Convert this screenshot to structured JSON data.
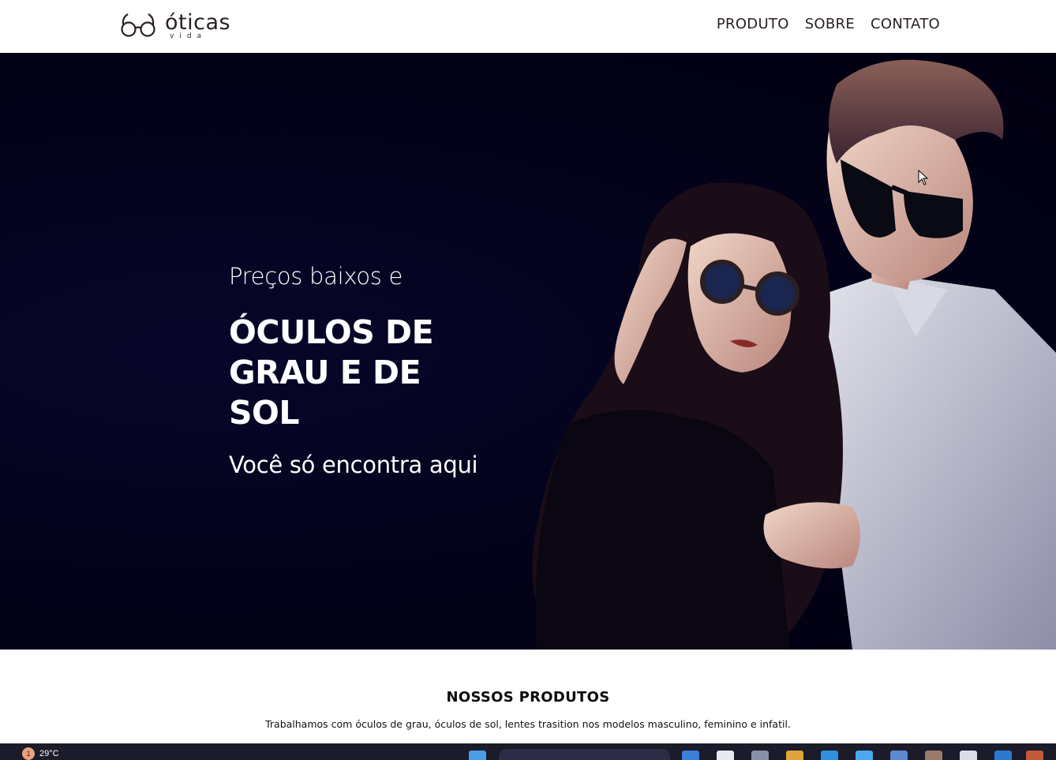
{
  "header": {
    "logo_text": "óticas",
    "logo_subtext": "vida",
    "nav": [
      "PRODUTO",
      "SOBRE",
      "CONTATO"
    ]
  },
  "hero": {
    "pretitle": "Preços baixos e",
    "title": "ÓCULOS DE GRAU E DE SOL",
    "subtitle": "Você só encontra aqui"
  },
  "products": {
    "title": "NOSSOS PRODUTOS",
    "description": "Trabalhamos com óculos de grau, óculos de sol, lentes trasition nos modelos masculino, feminino e infatil."
  },
  "taskbar": {
    "weather_badge": "1",
    "temperature": "29°C"
  }
}
